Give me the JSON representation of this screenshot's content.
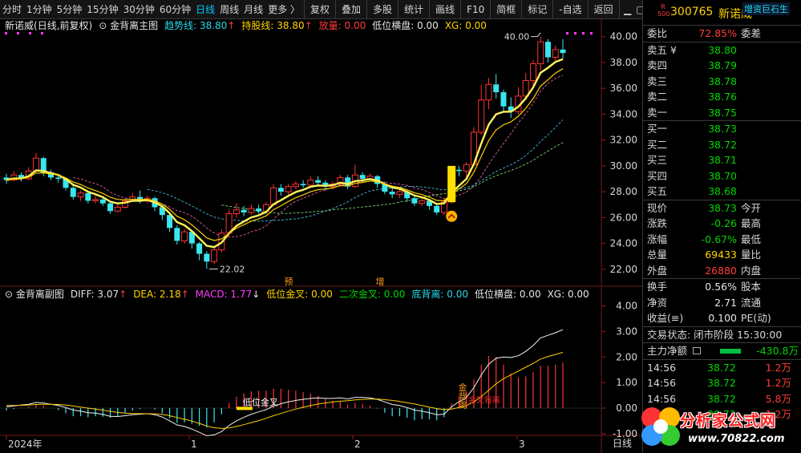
{
  "toolbar": {
    "left_items": [
      "分时",
      "1分钟",
      "5分钟",
      "15分钟",
      "30分钟",
      "60分钟",
      "日线",
      "周线",
      "月线",
      "更多 〉"
    ],
    "right_items": [
      "复权",
      "叠加",
      "多股",
      "统计",
      "画线",
      "F10",
      "简框",
      "标记",
      "-自选",
      "返回"
    ]
  },
  "main_header": {
    "stock": "新诺威",
    "mode": "(日线,前复权)",
    "indicator": "金背离主图",
    "trend_label": "趋势线: 38.80",
    "hold_label": "持股线: 38.80",
    "volume_label": "放量: 0.00",
    "low_label": "低位横盘: 0.00",
    "xg_label": "XG: 0.00"
  },
  "sub_header": {
    "indicator": "金背离副图",
    "diff": "DIFF: 3.07",
    "dea": "DEA: 2.18",
    "macd": "MACD: 1.77",
    "low_cross": "低位金叉: 0.00",
    "second_cross": "二次金叉: 0.00",
    "bottom_div": "底背离: 0.00",
    "low_flat": "低位横盘: 0.00",
    "xg": "XG: 0.00"
  },
  "price_axis": [
    "40.00",
    "38.00",
    "36.00",
    "34.00",
    "32.00",
    "30.00",
    "28.00",
    "26.00",
    "24.00",
    "22.00"
  ],
  "sub_axis": [
    "4.00",
    "3.00",
    "2.00",
    "1.00",
    "0.00",
    "-1.00"
  ],
  "time_axis": [
    "2024年",
    "1",
    "2",
    "3"
  ],
  "period_label": "日线",
  "annotations": {
    "high": "40.00",
    "low": "22.02",
    "yu": "预",
    "zeng": "增",
    "low_cross_text": "低位金叉",
    "gold_div": "金背离",
    "buy_point": "金叉背离"
  },
  "quote": {
    "badge_top": "R",
    "badge_bottom": "500",
    "code": "300765",
    "name": "新诺威",
    "ticker_tag": "增资巨石生",
    "webi_label": "委比",
    "webi_value": "72.85%",
    "weicha_label": "委差",
    "asks": [
      {
        "label": "卖五 ¥",
        "price": "38.80"
      },
      {
        "label": "卖四",
        "price": "38.79"
      },
      {
        "label": "卖三",
        "price": "38.78"
      },
      {
        "label": "卖二",
        "price": "38.76"
      },
      {
        "label": "卖一",
        "price": "38.75"
      }
    ],
    "bids": [
      {
        "label": "买一",
        "price": "38.73"
      },
      {
        "label": "买二",
        "price": "38.72"
      },
      {
        "label": "买三",
        "price": "38.71"
      },
      {
        "label": "买四",
        "price": "38.70"
      },
      {
        "label": "买五",
        "price": "38.68"
      }
    ],
    "stats": [
      {
        "l1": "现价",
        "v1": "38.73",
        "c1": "green",
        "l2": "今开",
        "v2": ""
      },
      {
        "l1": "涨跌",
        "v1": "-0.26",
        "c1": "green",
        "l2": "最高",
        "v2": ""
      },
      {
        "l1": "涨幅",
        "v1": "-0.67%",
        "c1": "green",
        "l2": "最低",
        "v2": ""
      },
      {
        "l1": "总量",
        "v1": "69433",
        "c1": "yellow",
        "l2": "量比",
        "v2": ""
      },
      {
        "l1": "外盘",
        "v1": "26880",
        "c1": "red",
        "l2": "内盘",
        "v2": ""
      }
    ],
    "stats2": [
      {
        "l1": "换手",
        "v1": "0.56%",
        "c1": "white",
        "l2": "股本",
        "v2": ""
      },
      {
        "l1": "净资",
        "v1": "2.71",
        "c1": "white",
        "l2": "流通",
        "v2": ""
      },
      {
        "l1": "收益(≡)",
        "v1": "0.100",
        "c1": "white",
        "l2": "PE(动)",
        "v2": ""
      }
    ],
    "trade_status": "交易状态: 闭市阶段 15:30:00",
    "main_flow_label": "主力净额",
    "main_flow_value": "-430.8万",
    "ticks": [
      {
        "time": "14:56",
        "price": "38.72",
        "vol": "1.2万"
      },
      {
        "time": "14:56",
        "price": "38.72",
        "vol": "1.2万"
      },
      {
        "time": "14:56",
        "price": "38.72",
        "vol": "5.8万"
      },
      {
        "time": "14:56",
        "price": "38.72",
        "vol": "1.2万"
      }
    ]
  },
  "watermark": {
    "text": "分析家公式网",
    "url": "www.70822.com"
  },
  "chart_data": {
    "type": "candlestick",
    "ylim": [
      21.0,
      40.6
    ],
    "candles": [
      [
        29.1,
        28.9,
        29.4,
        28.6
      ],
      [
        28.9,
        29.3,
        29.6,
        28.8
      ],
      [
        29.3,
        29.0,
        29.5,
        28.8
      ],
      [
        29.0,
        29.6,
        29.9,
        28.9
      ],
      [
        29.6,
        30.6,
        31.0,
        29.5
      ],
      [
        30.6,
        29.5,
        30.7,
        29.2
      ],
      [
        29.5,
        29.1,
        29.7,
        28.9
      ],
      [
        29.1,
        29.0,
        29.3,
        28.7
      ],
      [
        29.0,
        28.3,
        29.1,
        28.1
      ],
      [
        28.3,
        27.6,
        28.5,
        27.4
      ],
      [
        27.6,
        27.9,
        28.1,
        27.3
      ],
      [
        27.9,
        27.3,
        28.0,
        27.1
      ],
      [
        27.3,
        27.4,
        27.7,
        27.1
      ],
      [
        27.4,
        27.1,
        27.6,
        26.9
      ],
      [
        27.1,
        26.5,
        27.2,
        26.3
      ],
      [
        26.5,
        26.8,
        27.1,
        26.4
      ],
      [
        26.8,
        27.3,
        27.5,
        26.7
      ],
      [
        27.3,
        27.6,
        27.9,
        27.2
      ],
      [
        27.6,
        27.3,
        28.1,
        27.1
      ],
      [
        27.3,
        27.5,
        27.7,
        27.1
      ],
      [
        27.5,
        26.8,
        27.6,
        26.5
      ],
      [
        26.8,
        26.2,
        26.9,
        25.8
      ],
      [
        26.2,
        25.2,
        26.3,
        24.9
      ],
      [
        25.2,
        24.2,
        25.4,
        23.9
      ],
      [
        24.2,
        24.9,
        25.1,
        24.0
      ],
      [
        24.9,
        24.0,
        25.0,
        23.6
      ],
      [
        24.0,
        23.2,
        24.1,
        22.7
      ],
      [
        23.2,
        22.6,
        23.4,
        22.02
      ],
      [
        22.6,
        23.5,
        23.7,
        22.4
      ],
      [
        23.5,
        24.8,
        25.1,
        23.3
      ],
      [
        24.8,
        26.3,
        26.6,
        24.6
      ],
      [
        26.3,
        26.6,
        27.1,
        26.0
      ],
      [
        26.6,
        26.4,
        26.9,
        26.1
      ],
      [
        26.4,
        26.7,
        27.0,
        26.2
      ],
      [
        26.7,
        26.5,
        27.0,
        26.3
      ],
      [
        26.5,
        27.0,
        27.2,
        26.3
      ],
      [
        27.0,
        28.3,
        28.6,
        26.9
      ],
      [
        28.3,
        28.0,
        28.6,
        27.7
      ],
      [
        28.0,
        28.4,
        28.6,
        27.8
      ],
      [
        28.4,
        28.6,
        28.8,
        28.2
      ],
      [
        28.6,
        28.5,
        28.9,
        28.3
      ],
      [
        28.5,
        28.9,
        29.2,
        28.4
      ],
      [
        28.9,
        28.7,
        29.2,
        28.4
      ],
      [
        28.7,
        28.4,
        28.9,
        28.1
      ],
      [
        28.4,
        28.6,
        28.8,
        28.2
      ],
      [
        28.6,
        29.1,
        29.3,
        28.5
      ],
      [
        29.1,
        28.4,
        29.3,
        28.2
      ],
      [
        28.4,
        29.3,
        30.1,
        28.3
      ],
      [
        29.3,
        29.0,
        29.5,
        28.7
      ],
      [
        29.0,
        29.2,
        29.4,
        28.8
      ],
      [
        29.2,
        28.6,
        29.3,
        28.3
      ],
      [
        28.6,
        28.0,
        28.8,
        27.8
      ],
      [
        28.0,
        27.8,
        28.3,
        27.5
      ],
      [
        27.8,
        28.0,
        28.2,
        27.5
      ],
      [
        28.0,
        27.5,
        28.1,
        27.2
      ],
      [
        27.5,
        27.1,
        27.8,
        26.9
      ],
      [
        27.1,
        27.3,
        27.6,
        26.9
      ],
      [
        27.3,
        26.9,
        27.4,
        26.6
      ],
      [
        26.9,
        26.4,
        27.1,
        26.2
      ],
      [
        26.4,
        27.2,
        27.5,
        26.2
      ],
      [
        27.2,
        29.7,
        29.8,
        27.1
      ],
      [
        29.7,
        29.6,
        30.0,
        29.2
      ],
      [
        29.6,
        30.1,
        30.3,
        29.1
      ],
      [
        30.1,
        32.6,
        33.0,
        30.0
      ],
      [
        32.6,
        35.1,
        36.3,
        32.4
      ],
      [
        35.1,
        36.3,
        36.8,
        34.4
      ],
      [
        36.3,
        35.7,
        37.1,
        35.2
      ],
      [
        35.7,
        34.6,
        35.9,
        34.2
      ],
      [
        34.6,
        34.2,
        35.3,
        33.7
      ],
      [
        34.2,
        35.4,
        36.1,
        34.0
      ],
      [
        35.4,
        36.6,
        37.2,
        35.1
      ],
      [
        36.6,
        37.9,
        38.2,
        36.1
      ],
      [
        37.9,
        39.6,
        40.0,
        37.4
      ],
      [
        39.6,
        38.4,
        39.8,
        38.0
      ],
      [
        38.4,
        39.0,
        39.3,
        38.1
      ],
      [
        39.0,
        38.73,
        39.8,
        38.3
      ]
    ],
    "diff": [
      0.05,
      0.08,
      0.12,
      0.15,
      0.22,
      0.2,
      0.15,
      0.1,
      0.02,
      -0.08,
      -0.12,
      -0.18,
      -0.2,
      -0.25,
      -0.32,
      -0.33,
      -0.3,
      -0.26,
      -0.24,
      -0.22,
      -0.26,
      -0.35,
      -0.5,
      -0.66,
      -0.72,
      -0.82,
      -0.95,
      -1.08,
      -1.05,
      -0.92,
      -0.68,
      -0.5,
      -0.36,
      -0.24,
      -0.15,
      -0.06,
      0.08,
      0.17,
      0.24,
      0.3,
      0.34,
      0.38,
      0.4,
      0.38,
      0.38,
      0.4,
      0.36,
      0.42,
      0.42,
      0.4,
      0.34,
      0.24,
      0.14,
      0.1,
      0.02,
      -0.08,
      -0.12,
      -0.18,
      -0.26,
      -0.24,
      0.05,
      0.25,
      0.42,
      0.8,
      1.3,
      1.72,
      1.95,
      2.0,
      1.98,
      2.05,
      2.22,
      2.45,
      2.75,
      2.85,
      2.95,
      3.07
    ],
    "dea": [
      0.1,
      0.1,
      0.11,
      0.12,
      0.14,
      0.15,
      0.15,
      0.14,
      0.12,
      0.08,
      0.04,
      0.0,
      -0.04,
      -0.08,
      -0.13,
      -0.17,
      -0.2,
      -0.21,
      -0.22,
      -0.22,
      -0.23,
      -0.25,
      -0.3,
      -0.37,
      -0.44,
      -0.51,
      -0.6,
      -0.7,
      -0.77,
      -0.8,
      -0.78,
      -0.72,
      -0.65,
      -0.57,
      -0.49,
      -0.4,
      -0.3,
      -0.21,
      -0.12,
      -0.04,
      0.03,
      0.1,
      0.16,
      0.2,
      0.24,
      0.27,
      0.29,
      0.32,
      0.34,
      0.35,
      0.35,
      0.33,
      0.3,
      0.26,
      0.21,
      0.16,
      0.1,
      0.04,
      -0.02,
      -0.06,
      -0.04,
      0.02,
      0.1,
      0.24,
      0.45,
      0.7,
      0.95,
      1.15,
      1.3,
      1.45,
      1.6,
      1.75,
      1.92,
      2.02,
      2.1,
      2.18
    ]
  }
}
